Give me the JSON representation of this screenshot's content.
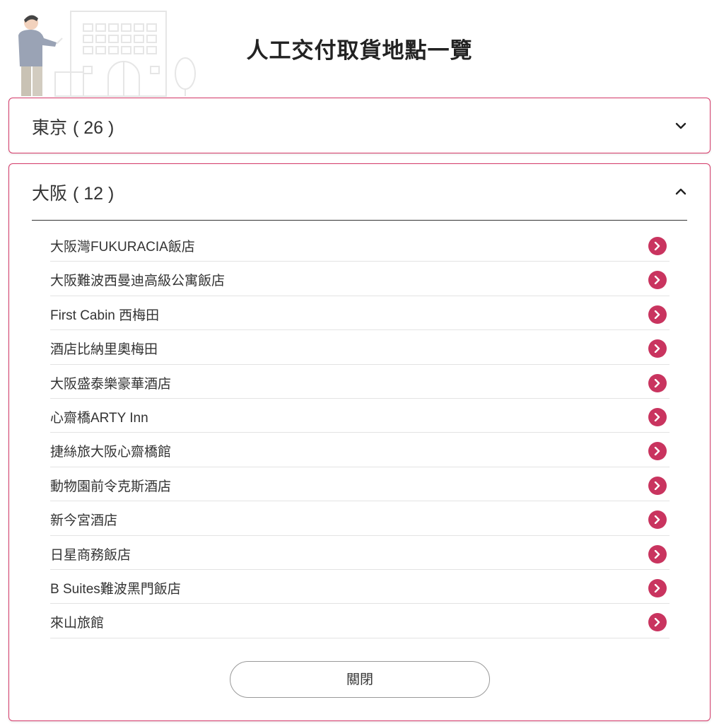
{
  "header": {
    "title": "人工交付取貨地點一覽"
  },
  "regions": [
    {
      "name": "東京",
      "count": "( 26 )",
      "expanded": false
    },
    {
      "name": "大阪",
      "count": "( 12 )",
      "expanded": true
    }
  ],
  "osaka_locations": [
    "大阪灣FUKURACIA飯店",
    "大阪難波西曼迪高級公寓飯店",
    "First Cabin 西梅田",
    "酒店比納里奧梅田",
    "大阪盛泰樂豪華酒店",
    "心齋橋ARTY Inn",
    "捷絲旅大阪心齋橋館",
    "動物園前令克斯酒店",
    "新今宮酒店",
    "日星商務飯店",
    "B Suites難波黑門飯店",
    "來山旅館"
  ],
  "close_label": "關閉",
  "colors": {
    "accent": "#c9345f",
    "border": "#d63a6a"
  }
}
